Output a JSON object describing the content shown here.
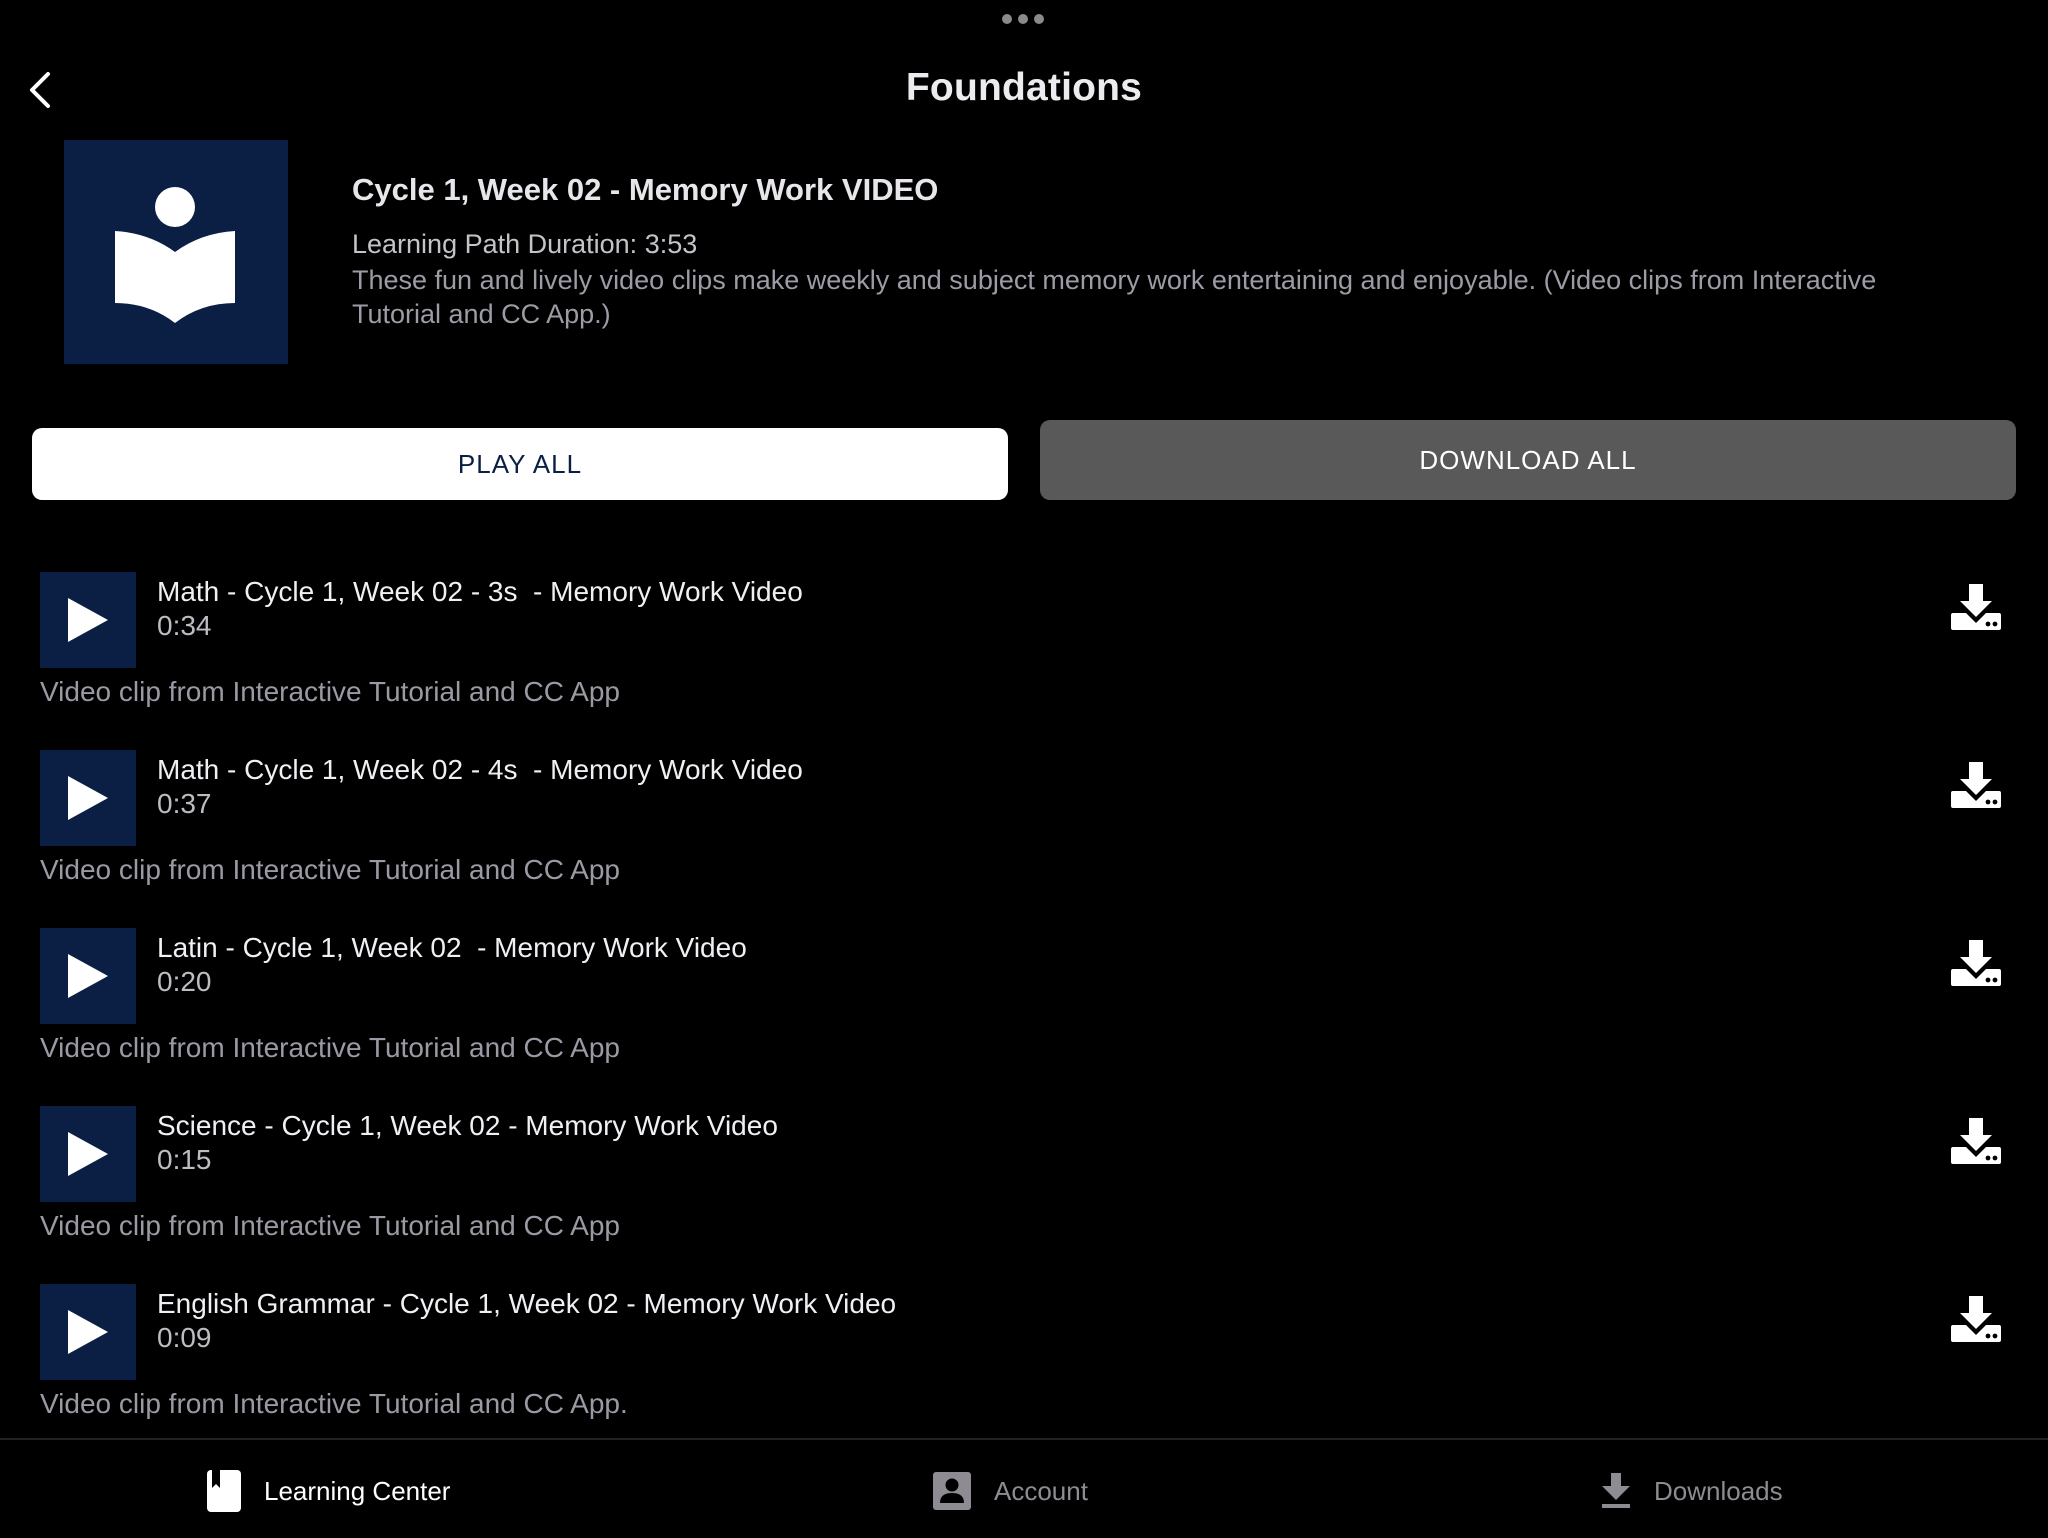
{
  "header": {
    "title": "Foundations",
    "back_icon": "chevron-left-icon",
    "more_icon": "more-dots-icon"
  },
  "course": {
    "thumbnail_icon": "reader-book-icon",
    "title": "Cycle 1, Week 02 - Memory Work VIDEO",
    "duration": "Learning Path Duration: 3:53",
    "description": "These fun and lively video clips make weekly and subject memory work entertaining and enjoyable. (Video clips from Interactive Tutorial and CC App.)"
  },
  "actions": {
    "play_all_label": "PLAY ALL",
    "download_all_label": "DOWNLOAD ALL"
  },
  "items": [
    {
      "title": "Math - Cycle 1, Week 02 - 3s  - Memory Work Video",
      "duration": "0:34",
      "description": "Video clip from Interactive Tutorial and CC App"
    },
    {
      "title": "Math - Cycle 1, Week 02 - 4s  - Memory Work Video",
      "duration": "0:37",
      "description": "Video clip from Interactive Tutorial and CC App"
    },
    {
      "title": "Latin - Cycle 1, Week 02  - Memory Work Video",
      "duration": "0:20",
      "description": "Video clip from Interactive Tutorial and CC App"
    },
    {
      "title": "Science - Cycle 1, Week 02 - Memory Work Video",
      "duration": "0:15",
      "description": "Video clip from Interactive Tutorial and CC App"
    },
    {
      "title": "English Grammar - Cycle 1, Week 02 - Memory Work Video",
      "duration": "0:09",
      "description": "Video clip from Interactive Tutorial and CC App."
    }
  ],
  "tabbar": {
    "tabs": [
      {
        "label": "Learning Center",
        "icon": "book-bookmark-icon",
        "active": true
      },
      {
        "label": "Account",
        "icon": "account-icon",
        "active": false
      },
      {
        "label": "Downloads",
        "icon": "download-icon",
        "active": false
      }
    ]
  },
  "colors": {
    "background": "#000000",
    "brand_navy": "#0b1f44",
    "download_all_bg": "#595959",
    "tab_inactive": "#8e8c92"
  }
}
